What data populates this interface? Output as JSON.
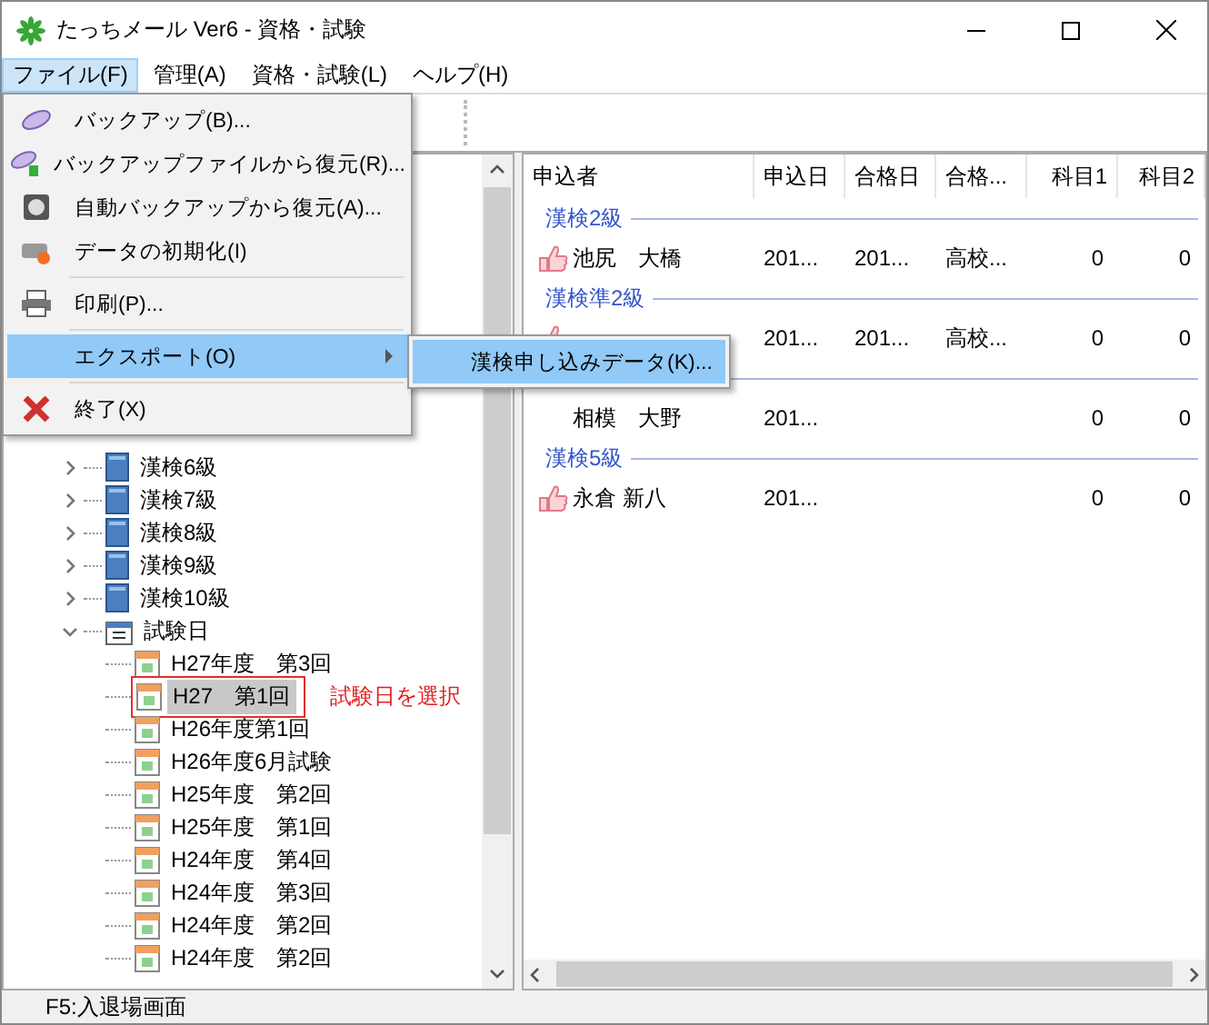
{
  "window": {
    "title": "たっちメール Ver6 - 資格・試験"
  },
  "menu_bar": [
    {
      "label": "ファイル(F)",
      "selected": true
    },
    {
      "label": "管理(A)",
      "selected": false
    },
    {
      "label": "資格・試験(L)",
      "selected": false
    },
    {
      "label": "ヘルプ(H)",
      "selected": false
    }
  ],
  "file_menu": [
    {
      "kind": "item",
      "label": "バックアップ(B)...",
      "selected": false
    },
    {
      "kind": "item",
      "label": "バックアップファイルから復元(R)...",
      "selected": false
    },
    {
      "kind": "item",
      "label": "自動バックアップから復元(A)...",
      "selected": false
    },
    {
      "kind": "item",
      "label": "データの初期化(I)",
      "selected": false
    },
    {
      "kind": "separator"
    },
    {
      "kind": "item",
      "label": "印刷(P)...",
      "selected": false
    },
    {
      "kind": "separator"
    },
    {
      "kind": "submenu",
      "label": "エクスポート(O)",
      "selected": true
    },
    {
      "kind": "separator"
    },
    {
      "kind": "item",
      "label": "終了(X)",
      "selected": false
    }
  ],
  "submenu": [
    {
      "label": "漢検申し込みデータ(K)...",
      "selected": true
    }
  ],
  "tree": [
    {
      "kind": "grade",
      "label": "漢検6級",
      "expanded": false
    },
    {
      "kind": "grade",
      "label": "漢検7級",
      "expanded": false
    },
    {
      "kind": "grade",
      "label": "漢検8級",
      "expanded": false
    },
    {
      "kind": "grade",
      "label": "漢検9級",
      "expanded": false
    },
    {
      "kind": "grade",
      "label": "漢検10級",
      "expanded": false
    },
    {
      "kind": "dates",
      "label": "試験日",
      "expanded": true,
      "children": [
        {
          "label": "H27年度　第3回",
          "selected": false
        },
        {
          "label": "H27　第1回",
          "selected": true
        },
        {
          "label": "H26年度第1回",
          "selected": false
        },
        {
          "label": "H26年度6月試験",
          "selected": false
        },
        {
          "label": "H25年度　第2回",
          "selected": false
        },
        {
          "label": "H25年度　第1回",
          "selected": false
        },
        {
          "label": "H24年度　第4回",
          "selected": false
        },
        {
          "label": "H24年度　第3回",
          "selected": false
        },
        {
          "label": "H24年度　第2回",
          "selected": false
        },
        {
          "label": "H24年度　第2回",
          "selected": false
        }
      ]
    }
  ],
  "annotation": {
    "text": "試験日を選択"
  },
  "list": {
    "columns": [
      "申込者",
      "申込日",
      "合格日",
      "合格...",
      "科目1",
      "科目2"
    ],
    "groups": [
      {
        "label": "漢検2級",
        "rows": [
          {
            "name": "池尻　大橋",
            "liked": true,
            "cells": [
              "201...",
              "201...",
              "高校...",
              "0",
              "0"
            ]
          }
        ]
      },
      {
        "label": "漢検準2級",
        "rows": [
          {
            "liked": true,
            "cells": [
              "201...",
              "201...",
              "高校...",
              "0",
              "0"
            ]
          }
        ]
      },
      {
        "rows": [
          {
            "name": "相模　大野",
            "liked": false,
            "cells": [
              "201...",
              "",
              "",
              "0",
              "0"
            ]
          }
        ]
      },
      {
        "label": "漢検5級",
        "rows": [
          {
            "name": "永倉 新八",
            "liked": true,
            "cells": [
              "201...",
              "",
              "",
              "0",
              "0"
            ]
          }
        ]
      }
    ]
  },
  "status_bar": {
    "text": "F5:入退場画面"
  }
}
